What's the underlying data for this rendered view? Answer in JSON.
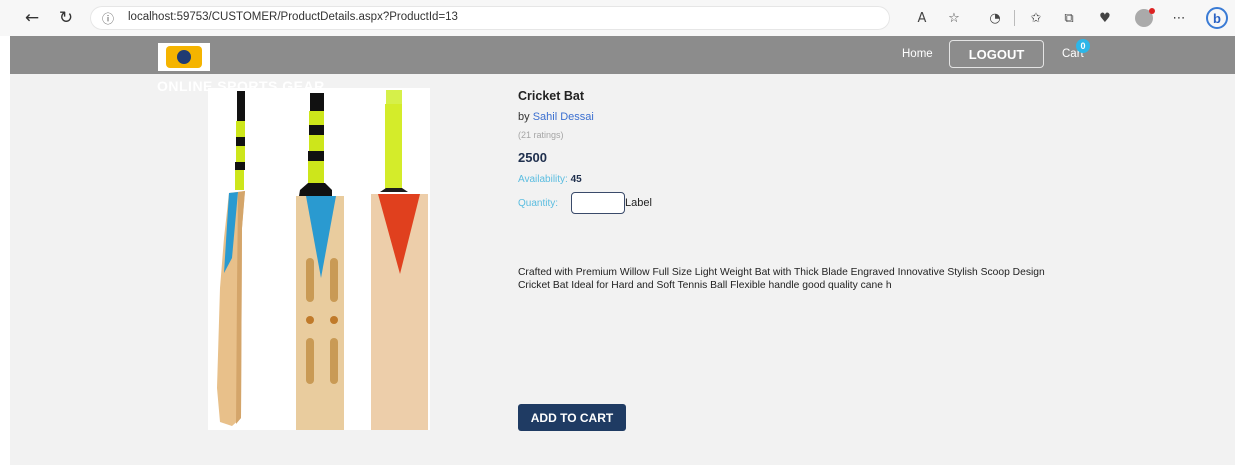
{
  "browser": {
    "url": "localhost:59753/CUSTOMER/ProductDetails.aspx?ProductId=13",
    "back_icon": "←",
    "refresh_icon": "↻",
    "info_icon": "ⓘ",
    "bing_label": "b"
  },
  "header": {
    "nav_home": "Home",
    "logout_label": "LOGOUT",
    "cart_label": "Cart",
    "cart_count": "0",
    "brand_text": "ONLINE SPORTS GEAR",
    "colors": {
      "bar": "#8c8c8c",
      "badge": "#2db6e8"
    }
  },
  "product": {
    "title": "Cricket Bat",
    "by_prefix": "by",
    "author": "Sahil Dessai",
    "ratings": "(21 ratings)",
    "price": "2500",
    "availability_label": "Availability:",
    "availability_value": "45",
    "quantity_label": "Quantity:",
    "quantity_value": "",
    "quantity_suffix": "Label",
    "description": "Crafted with Premium Willow Full Size Light Weight Bat with Thick Blade Engraved Innovative Stylish Scoop Design Cricket Bat Ideal for Hard and Soft Tennis Ball Flexible handle good quality cane h",
    "add_to_cart_label": "ADD TO CART",
    "colors": {
      "accent": "#1f3b63",
      "label_blue": "#5bbde0",
      "link": "#3b6fd0"
    }
  }
}
